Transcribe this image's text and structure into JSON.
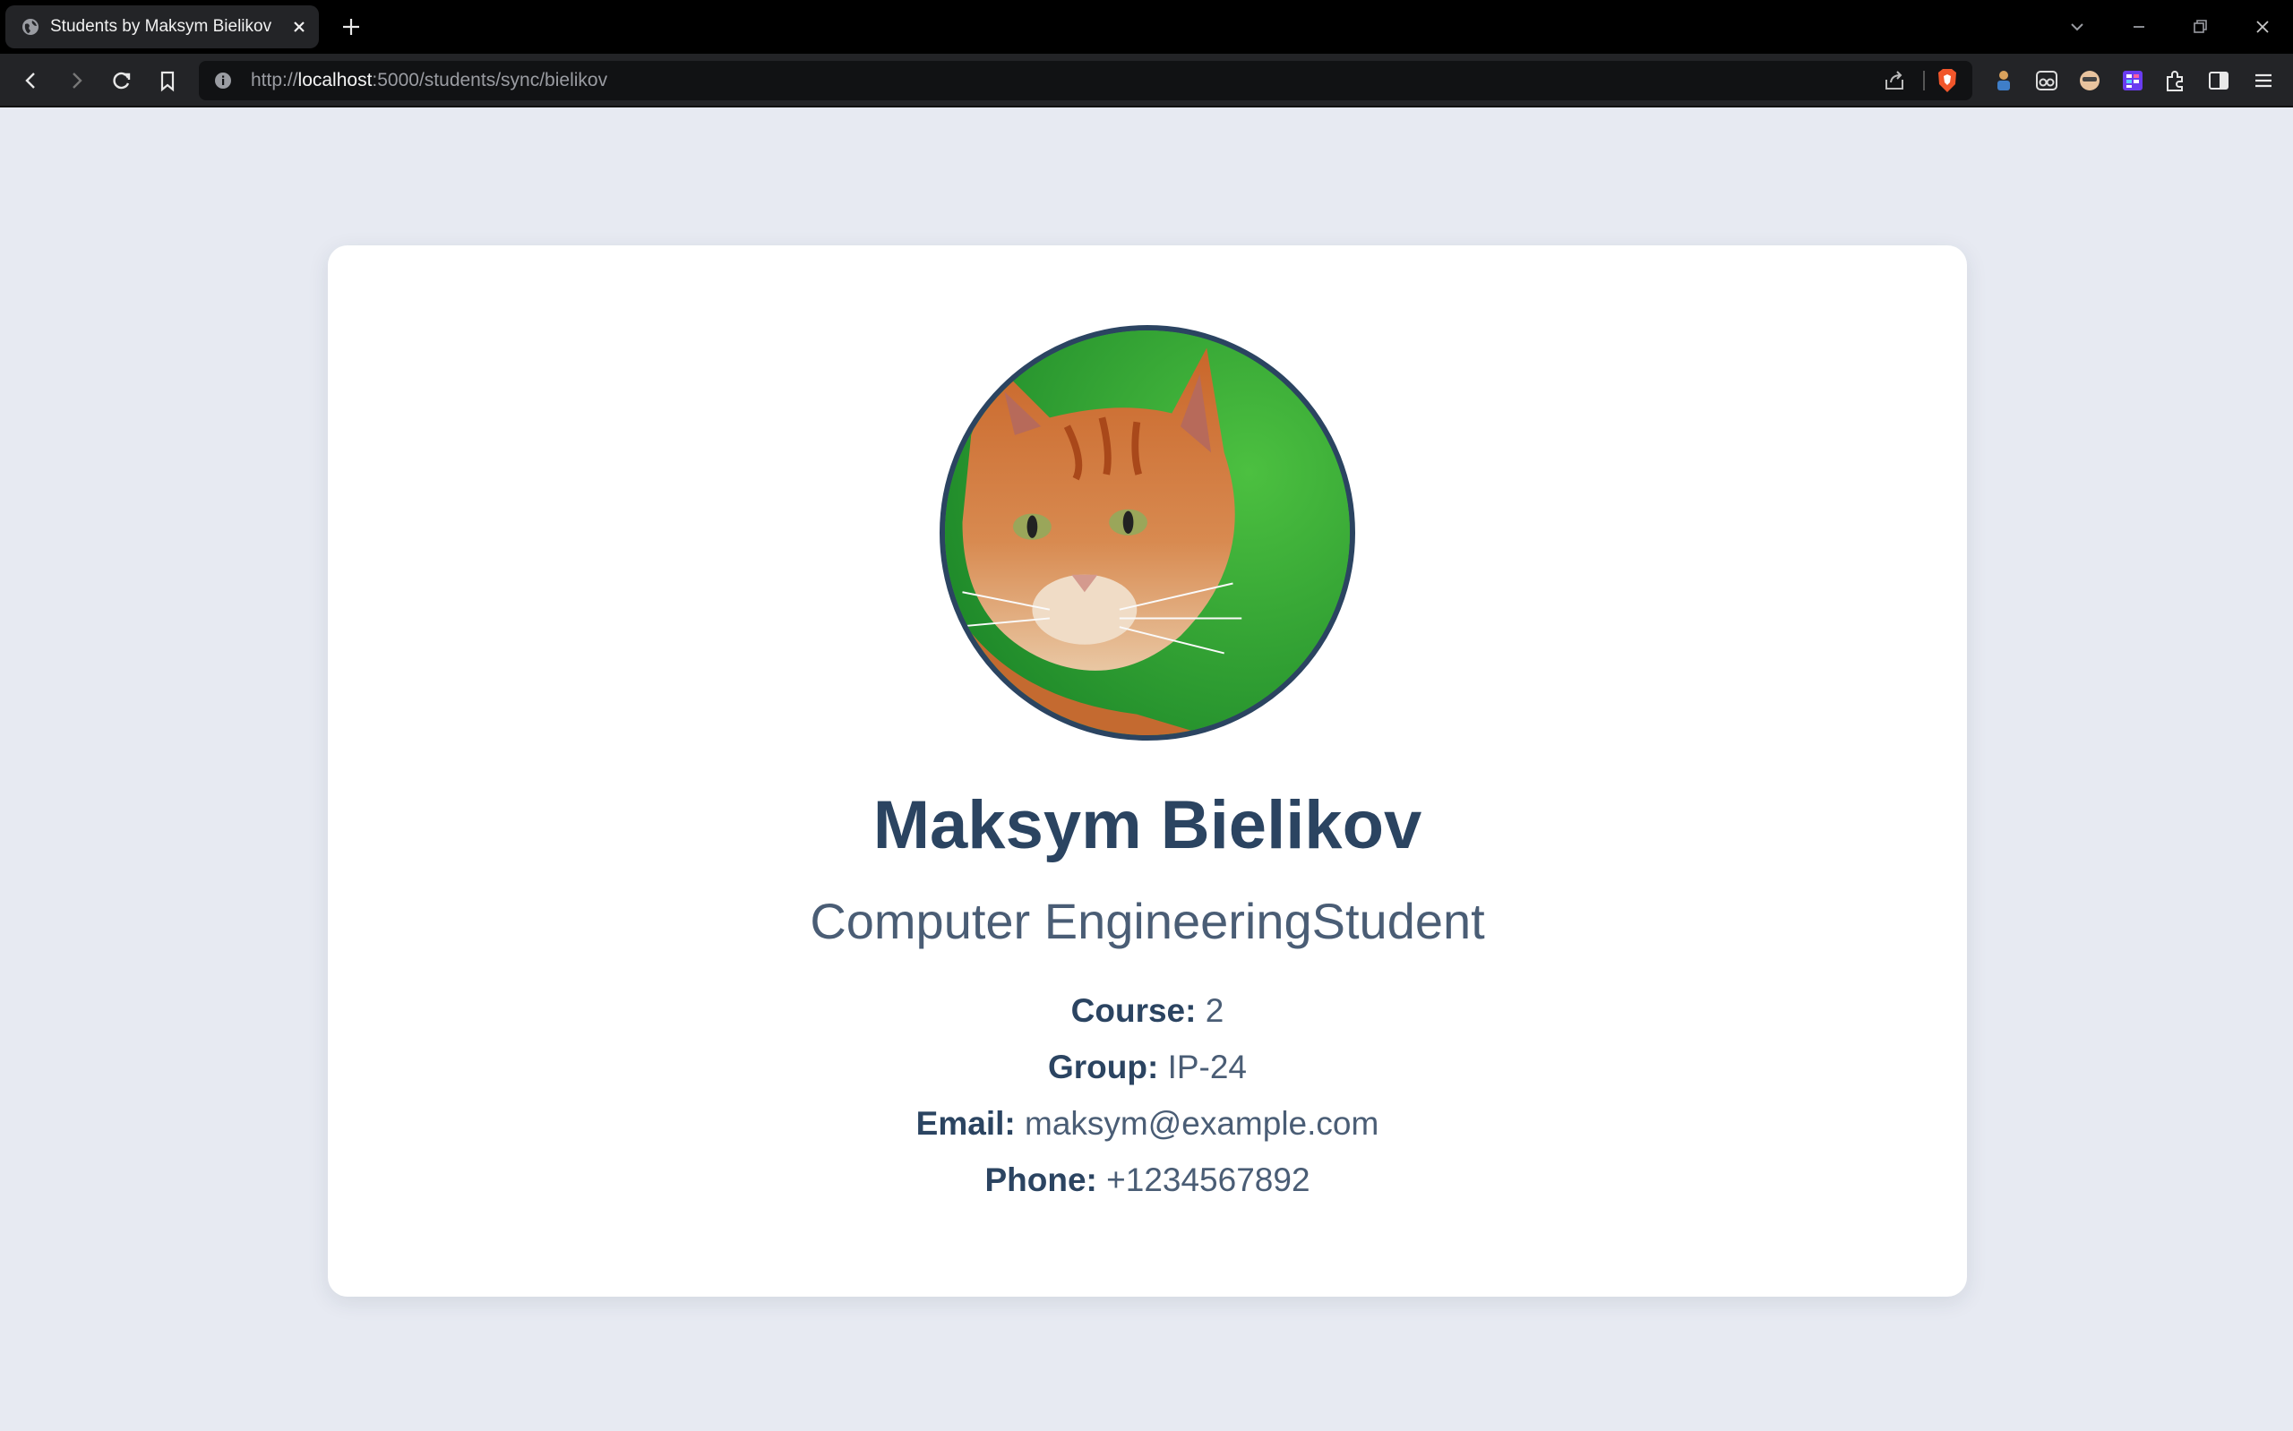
{
  "browser": {
    "tab_title": "Students by Maksym Bielikov",
    "url_scheme": "http://",
    "url_host": "localhost",
    "url_rest": ":5000/students/sync/bielikov"
  },
  "profile": {
    "name": "Maksym Bielikov",
    "subtitle": "Computer EngineeringStudent",
    "fields": [
      {
        "label": "Course:",
        "value": "2"
      },
      {
        "label": "Group:",
        "value": "IP-24"
      },
      {
        "label": "Email:",
        "value": "maksym@example.com"
      },
      {
        "label": "Phone:",
        "value": "+1234567892"
      }
    ]
  },
  "colors": {
    "page_background": "#e7eaf2",
    "card_background": "#ffffff",
    "accent": "#2b4461",
    "muted": "#4a5d75"
  },
  "icons": [
    "globe-icon",
    "close-icon",
    "plus-icon",
    "back-icon",
    "forward-icon",
    "reload-icon",
    "bookmark-icon",
    "info-icon",
    "share-icon",
    "brave-shield-icon",
    "extension-icon",
    "sidebar-icon",
    "menu-icon"
  ]
}
